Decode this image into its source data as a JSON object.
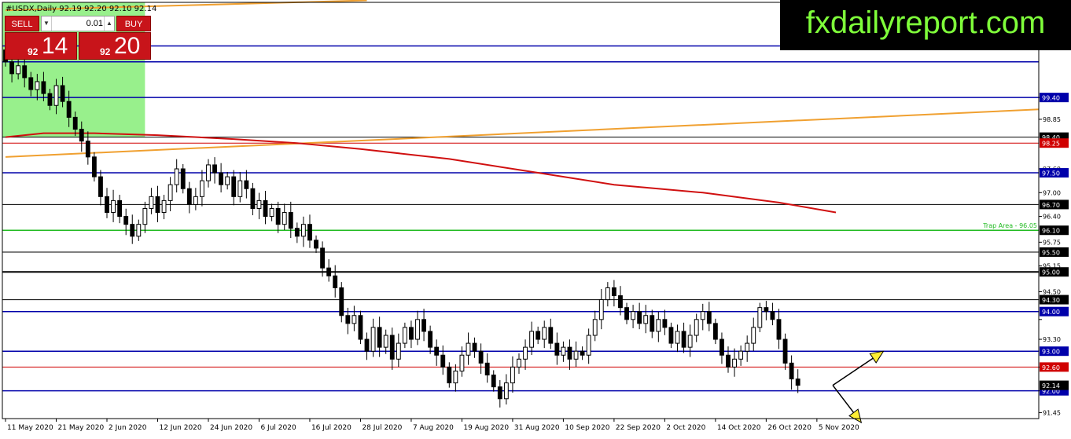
{
  "header": {
    "symbol_line": "#USDX,Daily  92.19 92.20 92.10 92.14"
  },
  "trade_panel": {
    "sell_label": "SELL",
    "buy_label": "BUY",
    "lot_value": "0.01",
    "sell_price_small": "92",
    "sell_price_big": "14",
    "buy_price_small": "92",
    "buy_price_big": "20"
  },
  "brand": {
    "text": "fxdailyreport.com"
  },
  "colors": {
    "candle": "#000000",
    "support_blue": "#0000aa",
    "level_black": "#000000",
    "level_red": "#d00000",
    "trap_green": "#22bb22",
    "moving_average": "#d01010",
    "trendline": "#f0a030",
    "zone_green": "#98f08c",
    "arrow_yellow": "#ffee33",
    "brand_bg": "#000000",
    "brand_text": "#7fff3a",
    "panel_red": "#c8141a"
  },
  "chart_data": {
    "type": "candlestick",
    "symbol": "#USDX",
    "timeframe": "Daily",
    "ylim": [
      91.3,
      101.8
    ],
    "y_ticks": [
      91.45,
      92.0,
      92.6,
      93.3,
      93.8,
      94.5,
      95.15,
      95.75,
      96.4,
      97.0,
      97.6,
      98.85,
      99.4
    ],
    "y_tick_labels": [
      "91.45",
      "",
      "",
      "93.30",
      "",
      "94.50",
      "95.15",
      "95.75",
      "96.40",
      "97.00",
      "97.60",
      "98.85",
      ""
    ],
    "x_ticks": [
      {
        "label": "11 May 2020",
        "i": 0
      },
      {
        "label": "21 May 2020",
        "i": 8
      },
      {
        "label": "2 Jun 2020",
        "i": 16
      },
      {
        "label": "12 Jun 2020",
        "i": 24
      },
      {
        "label": "24 Jun 2020",
        "i": 32
      },
      {
        "label": "6 Jul 2020",
        "i": 40
      },
      {
        "label": "16 Jul 2020",
        "i": 48
      },
      {
        "label": "28 Jul 2020",
        "i": 56
      },
      {
        "label": "7 Aug 2020",
        "i": 64
      },
      {
        "label": "19 Aug 2020",
        "i": 72
      },
      {
        "label": "31 Aug 2020",
        "i": 80
      },
      {
        "label": "10 Sep 2020",
        "i": 88
      },
      {
        "label": "22 Sep 2020",
        "i": 96
      },
      {
        "label": "2 Oct 2020",
        "i": 104
      },
      {
        "label": "14 Oct 2020",
        "i": 112
      },
      {
        "label": "26 Oct 2020",
        "i": 120
      },
      {
        "label": "5 Nov 2020",
        "i": 128
      }
    ],
    "x_range": [
      -0.5,
      163
    ],
    "closes": [
      100.3,
      100.0,
      100.2,
      99.9,
      99.6,
      99.8,
      99.5,
      99.2,
      99.7,
      99.3,
      98.9,
      98.6,
      98.3,
      97.9,
      97.4,
      96.9,
      96.5,
      96.8,
      96.4,
      96.2,
      95.9,
      96.2,
      96.6,
      96.9,
      96.5,
      96.8,
      97.2,
      97.6,
      97.1,
      96.7,
      96.9,
      97.3,
      97.7,
      97.5,
      97.2,
      97.4,
      96.9,
      97.3,
      97.1,
      96.6,
      96.8,
      96.4,
      96.6,
      96.2,
      96.5,
      96.1,
      95.9,
      96.2,
      95.8,
      95.6,
      95.1,
      94.9,
      94.6,
      93.9,
      93.7,
      93.9,
      93.3,
      93.0,
      93.6,
      93.1,
      93.4,
      92.8,
      93.2,
      93.6,
      93.3,
      93.8,
      93.5,
      93.1,
      92.9,
      92.6,
      92.2,
      92.5,
      92.9,
      93.2,
      93.0,
      92.7,
      92.4,
      92.1,
      91.8,
      92.2,
      92.6,
      92.8,
      93.1,
      93.5,
      93.3,
      93.6,
      93.2,
      92.9,
      93.1,
      92.8,
      93.0,
      92.9,
      93.4,
      93.8,
      94.3,
      94.6,
      94.4,
      94.1,
      93.8,
      94.0,
      93.7,
      93.9,
      93.5,
      93.8,
      93.6,
      93.2,
      93.5,
      93.1,
      93.4,
      93.8,
      94.0,
      93.7,
      93.3,
      92.9,
      92.6,
      92.8,
      93.0,
      93.2,
      93.6,
      94.1,
      94.0,
      93.8,
      93.3,
      92.7,
      92.3,
      92.14
    ],
    "levels": [
      {
        "value": 100.7,
        "style": "blue",
        "label": ""
      },
      {
        "value": 100.3,
        "style": "blue",
        "label": ""
      },
      {
        "value": 99.4,
        "style": "blue",
        "label": "99.40"
      },
      {
        "value": 98.4,
        "style": "black",
        "label": "98.40"
      },
      {
        "value": 98.25,
        "style": "red",
        "label": "98.25"
      },
      {
        "value": 97.5,
        "style": "blue",
        "label": "97.50"
      },
      {
        "value": 96.7,
        "style": "black",
        "label": "96.70"
      },
      {
        "value": 96.05,
        "style": "green",
        "label": "96.10"
      },
      {
        "value": 95.5,
        "style": "black",
        "label": "95.50"
      },
      {
        "value": 95.0,
        "style": "blackbold",
        "label": "95.00"
      },
      {
        "value": 94.3,
        "style": "black",
        "label": "94.30"
      },
      {
        "value": 94.0,
        "style": "blue",
        "label": "94.00"
      },
      {
        "value": 93.0,
        "style": "blue",
        "label": "93.00"
      },
      {
        "value": 92.6,
        "style": "red",
        "label": "92.60"
      },
      {
        "value": 92.0,
        "style": "blue",
        "label": "92.00"
      }
    ],
    "current_price_label": "92.14",
    "trap_area_label": "Trap Area - 96.05",
    "moving_average": {
      "points": [
        [
          0,
          98.4
        ],
        [
          6,
          98.5
        ],
        [
          14,
          98.5
        ],
        [
          24,
          98.45
        ],
        [
          36,
          98.35
        ],
        [
          46,
          98.25
        ],
        [
          56,
          98.1
        ],
        [
          70,
          97.85
        ],
        [
          84,
          97.5
        ],
        [
          96,
          97.2
        ],
        [
          110,
          97.0
        ],
        [
          122,
          96.75
        ],
        [
          131,
          96.5
        ]
      ]
    },
    "trendlines": [
      {
        "from": [
          0,
          101.6
        ],
        "to": [
          57,
          101.85
        ]
      },
      {
        "from": [
          0,
          97.9
        ],
        "to": [
          163,
          99.1
        ]
      }
    ],
    "zone": {
      "from_i": -0.5,
      "to_i": 22,
      "y_low": 98.4,
      "y_high": 101.9
    },
    "arrows": [
      {
        "from": [
          130.5,
          92.14
        ],
        "to": [
          138.5,
          93.0
        ],
        "direction": "up"
      },
      {
        "from": [
          130.5,
          92.14
        ],
        "to": [
          135,
          91.2
        ],
        "direction": "down"
      }
    ]
  }
}
